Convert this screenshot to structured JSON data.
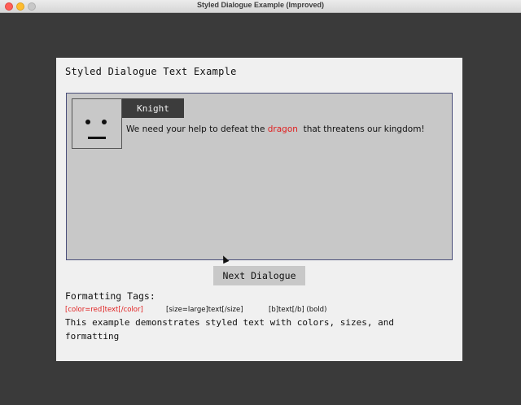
{
  "window": {
    "title": "Styled Dialogue Example (Improved)"
  },
  "panel": {
    "title": "Styled Dialogue Text Example"
  },
  "dialogue": {
    "speaker": "Knight",
    "text_before": "We need your help to defeat the ",
    "highlight": "dragon",
    "text_after": "  that threatens our kingdom!",
    "highlight_color": "#e02020"
  },
  "controls": {
    "next_label": "Next Dialogue"
  },
  "formatting": {
    "heading": "Formatting Tags:",
    "tag_color": "[color=red]text[/color]",
    "tag_size": "[size=large]text[/size]",
    "tag_bold": "[b]text[/b] (bold)",
    "description": "This example demonstrates styled text with colors, sizes, and formatting"
  }
}
